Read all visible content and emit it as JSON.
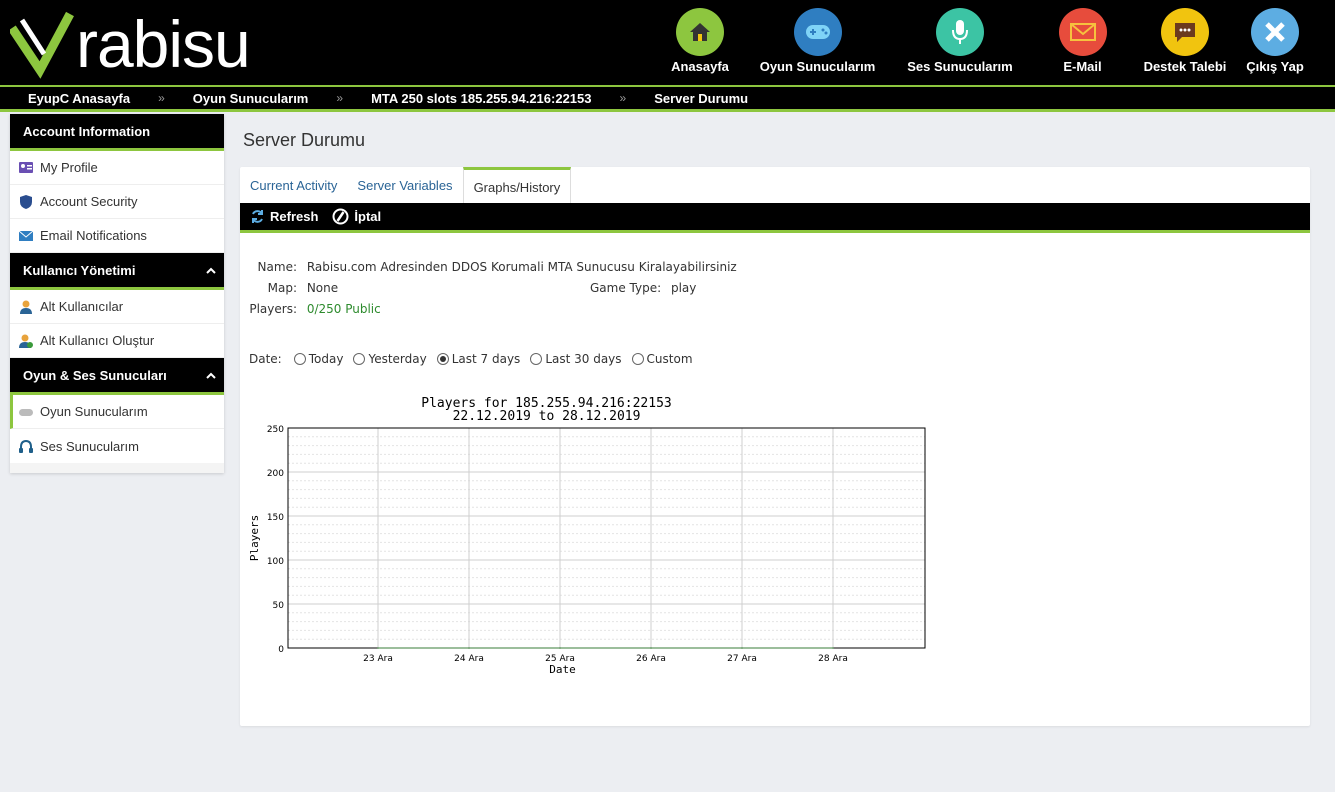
{
  "brand": {
    "name": "rabisu"
  },
  "nav": [
    {
      "label": "Anasayfa",
      "icon": "home-icon",
      "color": "#8dc63f"
    },
    {
      "label": "Oyun Sunucularım",
      "icon": "gamepad-icon",
      "color": "#2f7ec1"
    },
    {
      "label": "Ses Sunucularım",
      "icon": "microphone-icon",
      "color": "#3cc4a4"
    },
    {
      "label": "E-Mail",
      "icon": "envelope-icon",
      "color": "#e74c3c"
    },
    {
      "label": "Destek Talebi",
      "icon": "chat-bubble-icon",
      "color": "#f1c40f"
    },
    {
      "label": "Çıkış Yap",
      "icon": "close-x-icon",
      "color": "#5dade2"
    }
  ],
  "breadcrumb": [
    "EyupC Anasayfa",
    "Oyun Sunucularım",
    "MTA 250 slots 185.255.94.216:22153",
    "Server Durumu"
  ],
  "breadcrumb_sep": "»",
  "sidebar": {
    "account": {
      "title": "Account Information",
      "items": [
        "My Profile",
        "Account Security",
        "Email Notifications"
      ]
    },
    "users": {
      "title": "Kullanıcı Yönetimi",
      "items": [
        "Alt Kullanıcılar",
        "Alt Kullanıcı Oluştur"
      ]
    },
    "servers": {
      "title": "Oyun & Ses Sunucuları",
      "items": [
        "Oyun Sunucularım",
        "Ses Sunucularım"
      ]
    }
  },
  "page_title": "Server Durumu",
  "tabs": [
    "Current Activity",
    "Server Variables",
    "Graphs/History"
  ],
  "active_tab": "Graphs/History",
  "toolbar": {
    "refresh": "Refresh",
    "cancel": "İptal"
  },
  "server": {
    "name_label": "Name:",
    "name": "Rabisu.com Adresinden DDOS Korumali MTA Sunucusu Kiralayabilirsiniz",
    "map_label": "Map:",
    "map": "None",
    "game_type_label": "Game Type:",
    "game_type": "play",
    "players_label": "Players:",
    "players": "0/250 Public"
  },
  "date_filter": {
    "label": "Date:",
    "options": [
      "Today",
      "Yesterday",
      "Last 7 days",
      "Last 30 days",
      "Custom"
    ],
    "selected": "Last 7 days"
  },
  "chart_data": {
    "type": "line",
    "title": "Players for 185.255.94.216:22153",
    "subtitle": "22.12.2019 to 28.12.2019",
    "xlabel": "Date",
    "ylabel": "Players",
    "categories": [
      "23 Ara",
      "24 Ara",
      "25 Ara",
      "26 Ara",
      "27 Ara",
      "28 Ara"
    ],
    "yticks": [
      0,
      50,
      100,
      150,
      200,
      250
    ],
    "ylim": [
      0,
      250
    ],
    "series": [
      {
        "values": [
          0,
          0,
          0,
          0,
          0,
          0
        ]
      }
    ],
    "grid": true
  }
}
